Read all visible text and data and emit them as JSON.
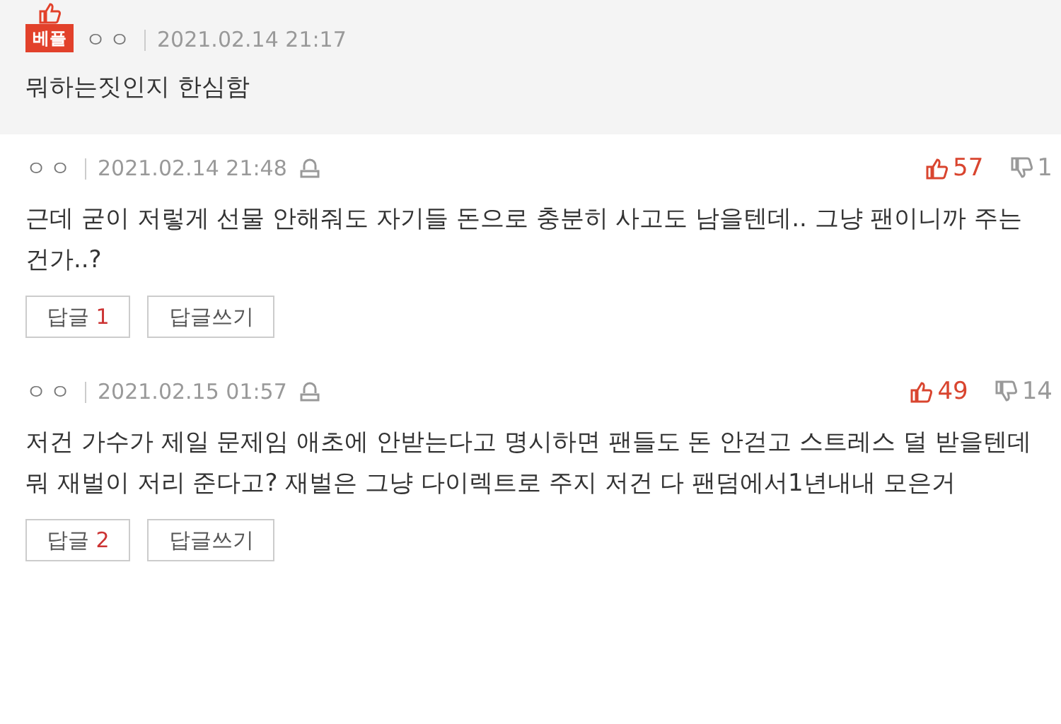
{
  "comments": [
    {
      "kind": "best",
      "badge": "베플",
      "author": "ㅇㅇ",
      "date": "2021.02.14 21:17",
      "text": "뭐하는짓인지 한심함"
    },
    {
      "kind": "normal",
      "author": "ㅇㅇ",
      "date": "2021.02.14 21:48",
      "likes": "57",
      "dislikes": "1",
      "text": "근데 굳이 저렇게 선물 안해줘도 자기들 돈으로 충분히 사고도 남을텐데.. 그냥 팬이니까 주는건가..?",
      "reply_label": "답글",
      "reply_count": "1",
      "write_reply": "답글쓰기"
    },
    {
      "kind": "normal",
      "author": "ㅇㅇ",
      "date": "2021.02.15 01:57",
      "likes": "49",
      "dislikes": "14",
      "text": "저건 가수가 제일 문제임 애초에 안받는다고 명시하면 팬들도 돈 안걷고 스트레스 덜 받을텐데 뭐 재벌이 저리 준다고? 재벌은 그냥 다이렉트로 주지 저건 다 팬덤에서1년내내 모은거",
      "reply_label": "답글",
      "reply_count": "2",
      "write_reply": "답글쓰기"
    }
  ]
}
